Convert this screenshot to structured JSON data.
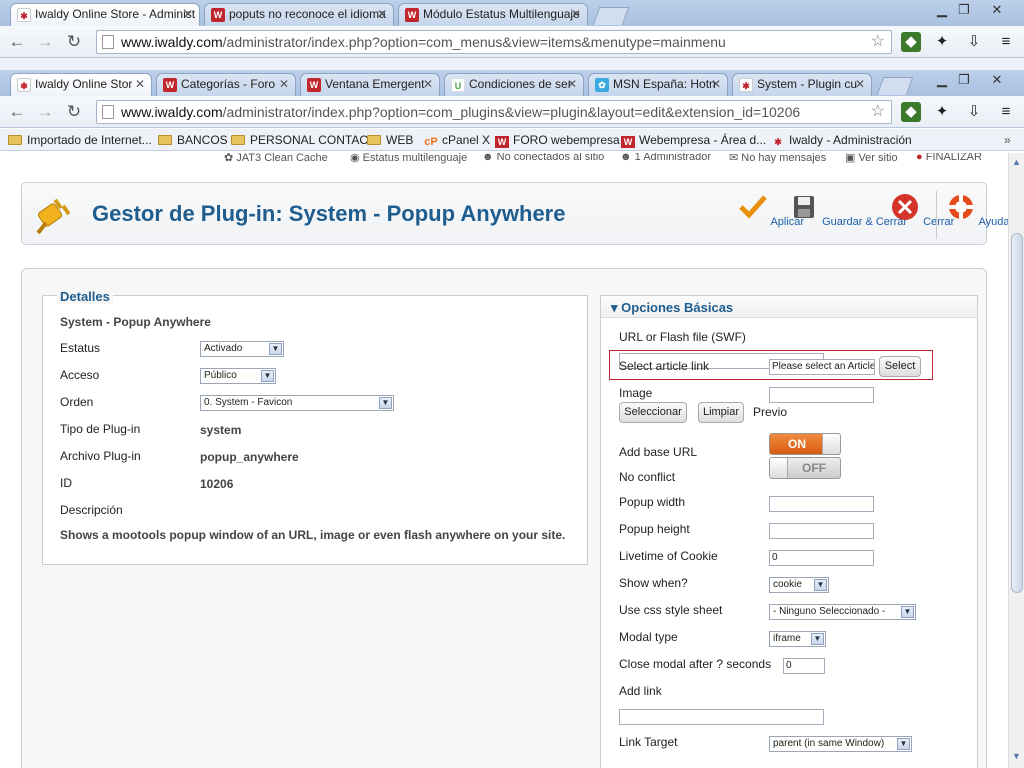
{
  "window1": {
    "tabs": [
      {
        "title": "Iwaldy Online Store - Administ",
        "icon": "iwaldy"
      },
      {
        "title": "poputs no reconoce el idioma",
        "icon": "webempresa"
      },
      {
        "title": "Módulo Estatus Multilenguaje",
        "icon": "webempresa"
      }
    ],
    "url_host": "www.iwaldy.com",
    "url_path": "/administrator/index.php?option=com_menus&view=items&menutype=mainmenu"
  },
  "window2": {
    "tabs": [
      {
        "title": "Iwaldy Online Stor",
        "icon": "iwaldy"
      },
      {
        "title": "Categorías - Foro",
        "icon": "webempresa"
      },
      {
        "title": "Ventana Emergent",
        "icon": "webempresa"
      },
      {
        "title": "Condiciones de ser",
        "icon": "u"
      },
      {
        "title": "MSN España: Hotn",
        "icon": "msn"
      },
      {
        "title": "System - Plugin cu",
        "icon": "iwaldy"
      }
    ],
    "url_host": "www.iwaldy.com",
    "url_path": "/administrator/index.php?option=com_plugins&view=plugin&layout=edit&extension_id=10206"
  },
  "bookmarks": [
    {
      "label": "Importado de Internet...",
      "kind": "folder"
    },
    {
      "label": "BANCOS",
      "kind": "folder"
    },
    {
      "label": "PERSONAL CONTACT",
      "kind": "folder"
    },
    {
      "label": "WEB",
      "kind": "folder"
    },
    {
      "label": "cPanel X",
      "kind": "cpanel"
    },
    {
      "label": "FORO webempresa",
      "kind": "webempresa"
    },
    {
      "label": "Webempresa - Área d...",
      "kind": "webempresa"
    },
    {
      "label": "Iwaldy - Administración",
      "kind": "iwaldy"
    }
  ],
  "status_bar": {
    "items": [
      "JAT3 Clean Cache",
      "Estatus multilenguaje",
      "No conectados al sitio",
      "1 Administrador",
      "No hay mensajes",
      "Ver sitio",
      "FINALIZAR"
    ]
  },
  "header": {
    "title": "Gestor de Plug-in: System - Popup Anywhere",
    "buttons": [
      "Aplicar",
      "Guardar & Cerrar",
      "Cerrar",
      "Ayuda"
    ]
  },
  "details": {
    "legend": "Detalles",
    "plugin_name": "System - Popup Anywhere",
    "fields": {
      "estatus_label": "Estatus",
      "estatus_value": "Activado",
      "acceso_label": "Acceso",
      "acceso_value": "Público",
      "orden_label": "Orden",
      "orden_value": "0. System - Favicon",
      "tipo_label": "Tipo de Plug-in",
      "tipo_value": "system",
      "archivo_label": "Archivo Plug-in",
      "archivo_value": "popup_anywhere",
      "id_label": "ID",
      "id_value": "10206",
      "descripcion_label": "Descripción"
    },
    "description": "Shows a mootools popup window of an URL, image or even flash anywhere on your site."
  },
  "options": {
    "heading": "Opciones Básicas",
    "url_label": "URL or Flash file (SWF)",
    "url_value": "",
    "article_label": "Select article link",
    "article_placeholder": "Please select an Article",
    "select_button": "Select",
    "image_label": "Image",
    "image_value": "",
    "seleccionar_button": "Seleccionar",
    "limpiar_button": "Limpiar",
    "previo_label": "Previo",
    "base_url_label": "Add base URL",
    "base_url_state": "ON",
    "no_conflict_label": "No conflict",
    "no_conflict_state": "OFF",
    "popup_width_label": "Popup width",
    "popup_width_value": "",
    "popup_height_label": "Popup height",
    "popup_height_value": "",
    "cookie_label": "Livetime of Cookie",
    "cookie_value": "0",
    "show_when_label": "Show when?",
    "show_when_value": "cookie",
    "css_label": "Use css style sheet",
    "css_value": "- Ninguno Seleccionado -",
    "modal_type_label": "Modal type",
    "modal_type_value": "iframe",
    "close_after_label": "Close modal after ? seconds",
    "close_after_value": "0",
    "add_link_label": "Add link",
    "add_link_value": "",
    "link_target_label": "Link Target",
    "link_target_value": "parent (in same Window)"
  }
}
